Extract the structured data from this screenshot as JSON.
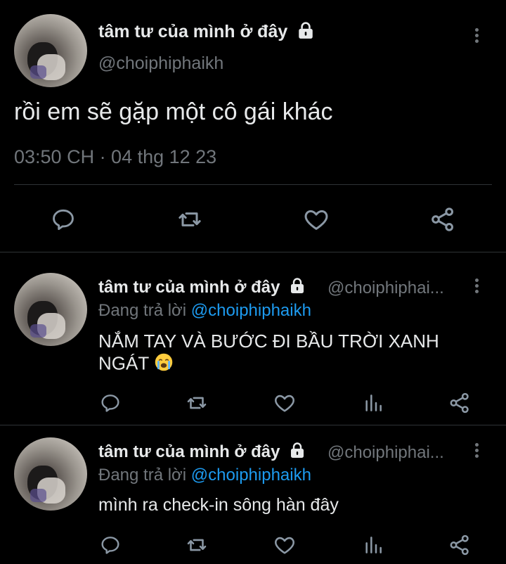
{
  "main_tweet": {
    "display_name": "tâm tư của mình ở đây",
    "handle": "@choiphiphaikh",
    "text": "rồi em sẽ gặp một cô gái khác",
    "timestamp": "03:50 CH · 04 thg 12 23",
    "icons": [
      "more-vertical-icon",
      "lock-icon",
      "reply-icon",
      "retweet-icon",
      "like-icon",
      "share-icon"
    ]
  },
  "replies": [
    {
      "display_name": "tâm tư của mình ở đây",
      "handle": "@choiphiphai...",
      "replying_label": "Đang trả lời",
      "replying_to": "@choiphiphaikh",
      "text": "NẮM TAY VÀ BƯỚC ĐI BẦU TRỜI XANH NGÁT",
      "emoji": "crying-face-emoji"
    },
    {
      "display_name": "tâm tư của mình ở đây",
      "handle": "@choiphiphai...",
      "replying_label": "Đang trả lời",
      "replying_to": "@choiphiphaikh",
      "text": "mình ra check-in sông hàn đây"
    }
  ],
  "colors": {
    "background": "#000000",
    "text": "#e7e9ea",
    "muted": "#71767b",
    "link": "#1d9bf0",
    "divider": "#2f3336"
  }
}
